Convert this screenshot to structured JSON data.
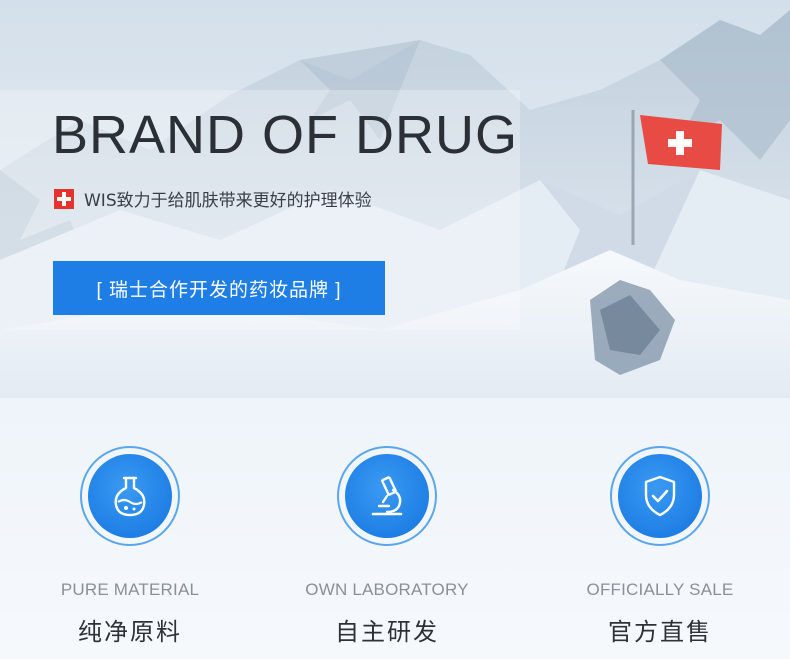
{
  "hero": {
    "title": "BRAND OF DRUG",
    "subtitle": "WIS致力于给肌肤带来更好的护理体验",
    "cta_label": "[  瑞士合作开发的药妆品牌  ]",
    "icons": [
      "swiss-flag-icon"
    ]
  },
  "features": [
    {
      "en": "PURE MATERIAL",
      "cn": "纯净原料",
      "icon": "flask-icon"
    },
    {
      "en": "OWN LABORATORY",
      "cn": "自主研发",
      "icon": "microscope-icon"
    },
    {
      "en": "OFFICIALLY SALE",
      "cn": "官方直售",
      "icon": "shield-check-icon"
    }
  ],
  "colors": {
    "accent": "#1e7ee6",
    "title": "#2b2f36",
    "swiss_red": "#e5332b",
    "caption_gray": "#8a9099"
  }
}
